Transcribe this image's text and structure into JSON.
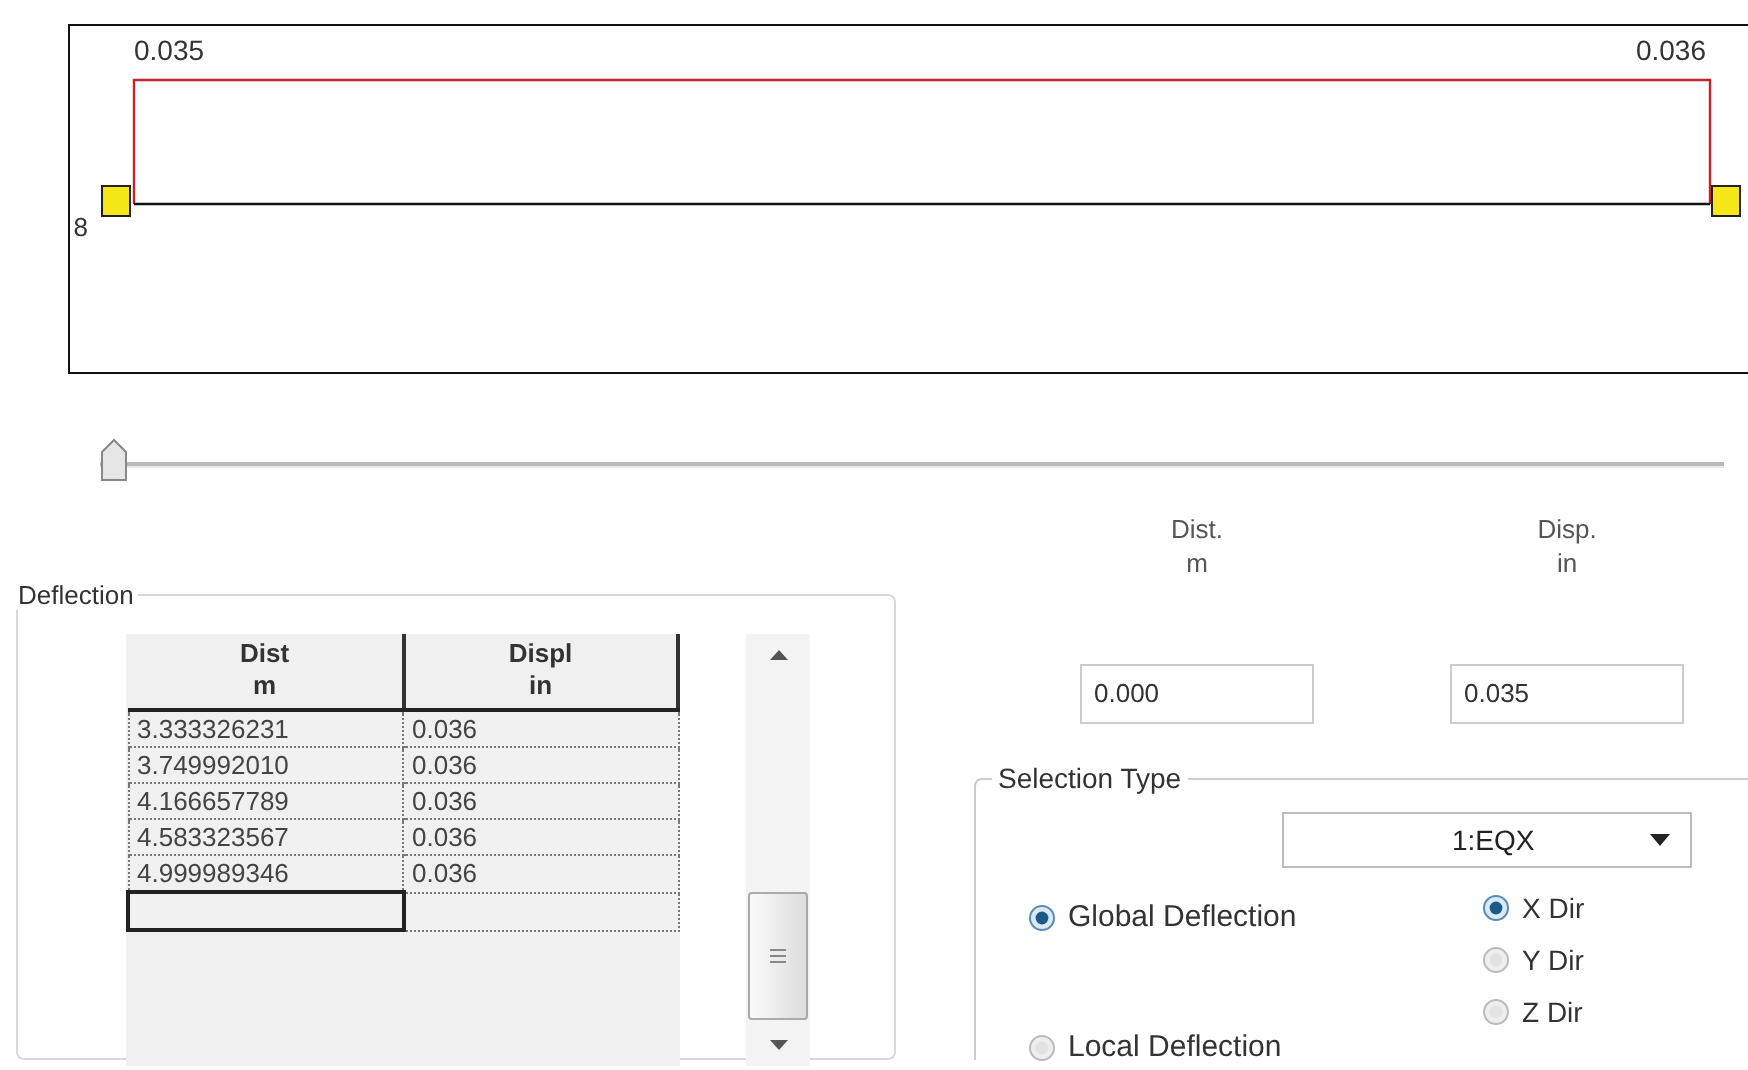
{
  "diagram": {
    "start_value": "0.035",
    "end_value": "0.036",
    "node_label": "8"
  },
  "slider": {
    "level": 0
  },
  "deflection": {
    "title": "Deflection",
    "columns": [
      {
        "name": "Dist",
        "unit": "m"
      },
      {
        "name": "Displ",
        "unit": "in"
      }
    ],
    "rows": [
      [
        "3.333326231",
        "0.036"
      ],
      [
        "3.749992010",
        "0.036"
      ],
      [
        "4.166657789",
        "0.036"
      ],
      [
        "4.583323567",
        "0.036"
      ],
      [
        "4.999989346",
        "0.036"
      ]
    ]
  },
  "readouts": [
    {
      "label": "Dist.",
      "unit": "m",
      "value": "0.000"
    },
    {
      "label": "Disp.",
      "unit": "in",
      "value": "0.035"
    }
  ],
  "selection_type": {
    "title": "Selection Type",
    "case": "1:EQX",
    "deflection_options": [
      {
        "label": "Global Deflection",
        "selected": true
      },
      {
        "label": "Local Deflection",
        "selected": false
      }
    ],
    "direction_options": [
      {
        "label": "X Dir",
        "selected": true
      },
      {
        "label": "Y Dir",
        "selected": false
      },
      {
        "label": "Z Dir",
        "selected": false
      }
    ]
  }
}
